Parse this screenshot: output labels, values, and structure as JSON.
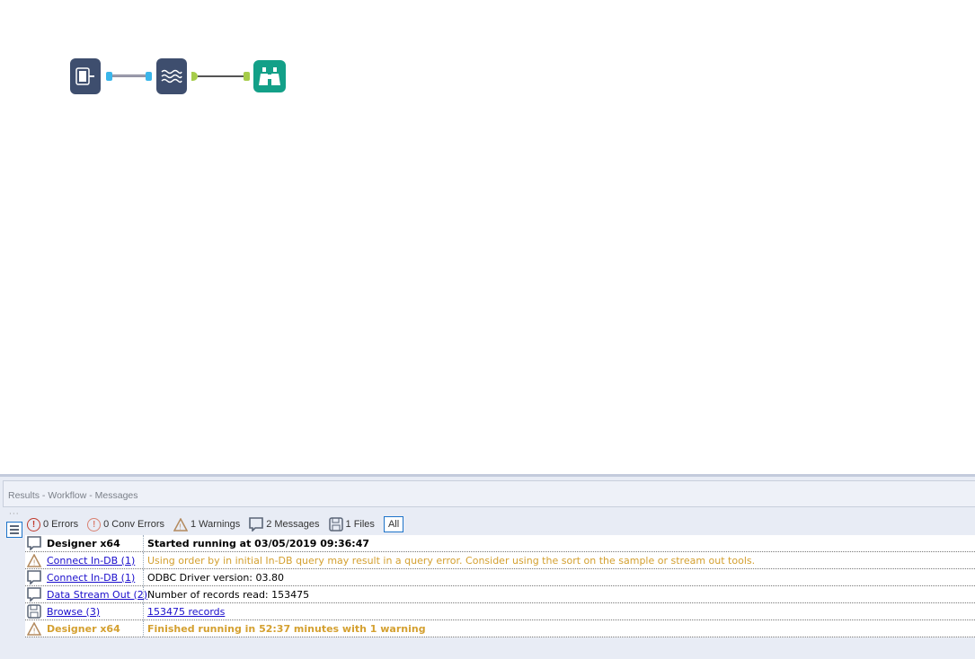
{
  "canvas": {
    "tools": [
      {
        "name": "Connect In-DB",
        "icon": "connect-in-db-icon"
      },
      {
        "name": "Data Stream Out",
        "icon": "data-stream-out-icon"
      },
      {
        "name": "Browse",
        "icon": "binoculars-icon"
      }
    ]
  },
  "results": {
    "header": "Results - Workflow - Messages",
    "filters": {
      "errors": "0 Errors",
      "conv_errors": "0 Conv Errors",
      "warnings": "1 Warnings",
      "messages": "2 Messages",
      "files": "1 Files",
      "all": "All"
    },
    "rows": [
      {
        "type": "message",
        "source": "Designer x64",
        "text": "Started running at 03/05/2019 09:36:47"
      },
      {
        "type": "warning",
        "source": "Connect In-DB (1)",
        "text": "Using order by in initial In-DB query may result in a query error.  Consider using the sort on the sample or stream out tools."
      },
      {
        "type": "message",
        "source": "Connect In-DB (1)",
        "text": "ODBC Driver version: 03.80"
      },
      {
        "type": "message",
        "source": "Data Stream Out (2)",
        "text": "Number of records read: 153475"
      },
      {
        "type": "file",
        "source": "Browse (3)",
        "text": "153475 records"
      },
      {
        "type": "warning",
        "source": "Designer x64",
        "text": "Finished running in 52:37 minutes with 1 warning"
      }
    ]
  }
}
